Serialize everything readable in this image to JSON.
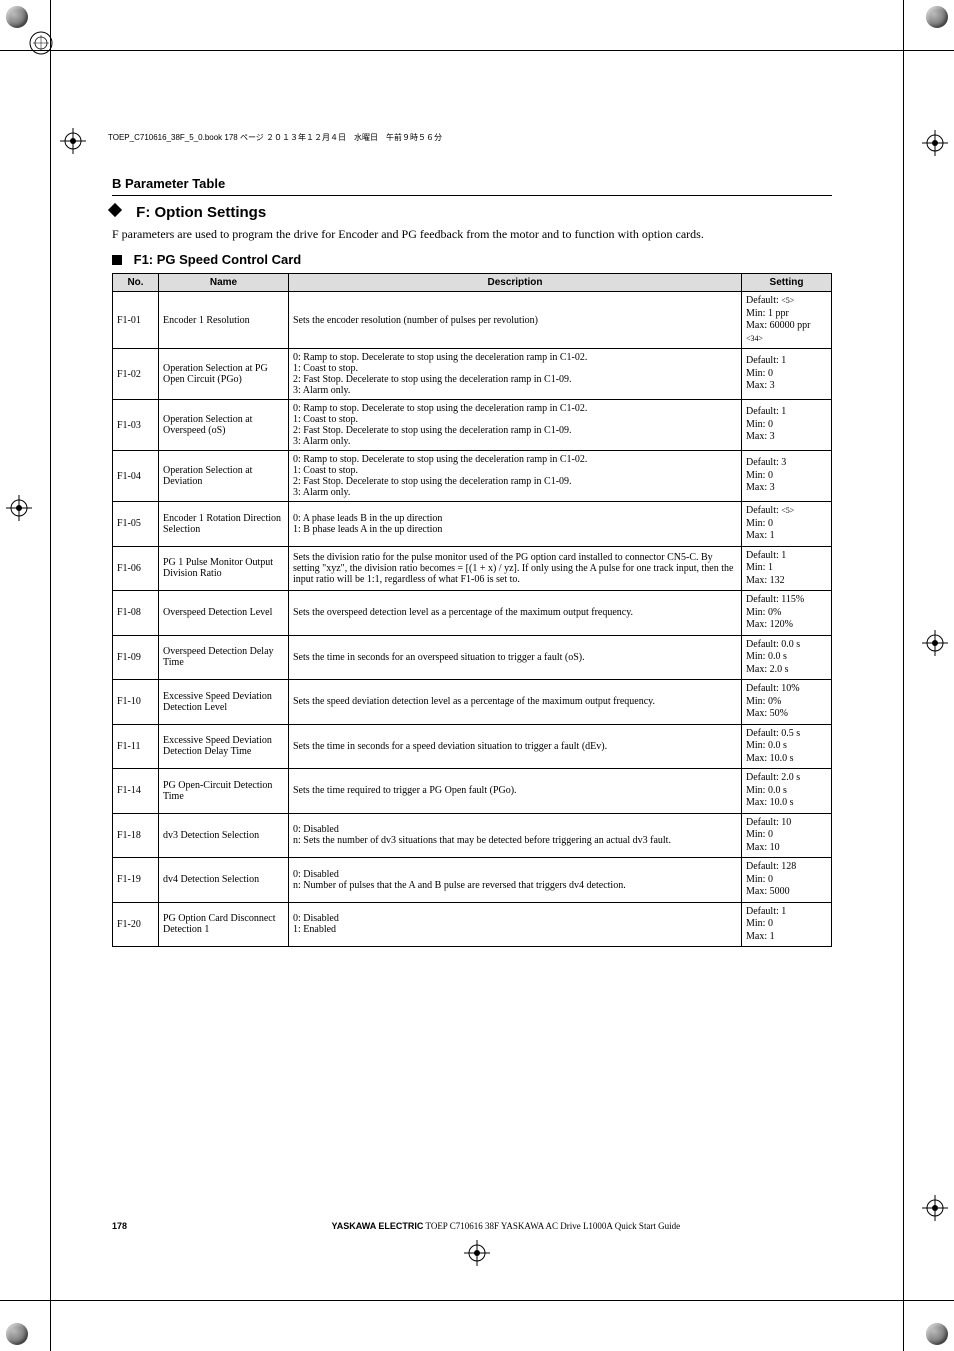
{
  "print_header": "TOEP_C710616_38F_5_0.book  178 ページ  ２０１３年１２月４日　水曜日　午前９時５６分",
  "section_header": "B  Parameter Table",
  "h2": "F: Option Settings",
  "intro": "F parameters are used to program the drive for Encoder and PG feedback from the motor and to function with option cards.",
  "h3": "F1: PG Speed Control Card",
  "columns": {
    "no": "No.",
    "name": "Name",
    "desc": "Description",
    "set": "Setting"
  },
  "rows": [
    {
      "no": "F1-01",
      "name": "Encoder 1 Resolution",
      "desc": "Sets the encoder resolution (number of pulses per revolution)",
      "setting": [
        "Default: <5>",
        "Min: 1 ppr",
        "Max: 60000 ppr <34>"
      ]
    },
    {
      "no": "F1-02",
      "name": "Operation Selection at PG Open Circuit (PGo)",
      "desc": "0: Ramp to stop. Decelerate to stop using the deceleration ramp in C1-02.\n1: Coast to stop.\n2: Fast Stop. Decelerate to stop using the deceleration ramp in C1-09.\n3: Alarm only.",
      "setting": [
        "Default: 1",
        "Min: 0",
        "Max: 3"
      ]
    },
    {
      "no": "F1-03",
      "name": "Operation Selection at Overspeed (oS)",
      "desc": "0: Ramp to stop. Decelerate to stop using the deceleration ramp in C1-02.\n1: Coast to stop.\n2: Fast Stop. Decelerate to stop using the deceleration ramp in C1-09.\n3: Alarm only.",
      "setting": [
        "Default: 1",
        "Min: 0",
        "Max: 3"
      ]
    },
    {
      "no": "F1-04",
      "name": "Operation Selection at Deviation",
      "desc": "0: Ramp to stop. Decelerate to stop using the deceleration ramp in C1-02.\n1: Coast to stop.\n2: Fast Stop. Decelerate to stop using the deceleration ramp in C1-09.\n3: Alarm only.",
      "setting": [
        "Default: 3",
        "Min: 0",
        "Max: 3"
      ]
    },
    {
      "no": "F1-05",
      "name": "Encoder 1 Rotation Direction Selection",
      "desc": "0: A phase leads B in the up direction\n1: B phase leads A in the up direction",
      "setting": [
        "Default: <5>",
        "Min: 0",
        "Max: 1"
      ]
    },
    {
      "no": "F1-06",
      "name": "PG 1 Pulse Monitor Output Division Ratio",
      "desc": "Sets the division ratio for the pulse monitor used of the PG option card installed to connector CN5-C. By setting \"xyz\", the division ratio becomes = [(1 + x) / yz]. If only using the A pulse for one track input, then the input ratio will be 1:1, regardless of what F1-06 is set to.",
      "setting": [
        "Default: 1",
        "Min: 1",
        "Max: 132"
      ]
    },
    {
      "no": "F1-08",
      "name": "Overspeed Detection Level",
      "desc": "Sets the overspeed detection level as a percentage of the maximum output frequency.",
      "setting": [
        "Default: 115%",
        "Min: 0%",
        "Max: 120%"
      ]
    },
    {
      "no": "F1-09",
      "name": "Overspeed Detection Delay Time",
      "desc": "Sets the time in seconds for an overspeed situation to trigger a fault (oS).",
      "setting": [
        "Default: 0.0 s",
        "Min: 0.0 s",
        "Max: 2.0 s"
      ]
    },
    {
      "no": "F1-10",
      "name": "Excessive Speed Deviation Detection Level",
      "desc": "Sets the speed deviation detection level as a percentage of the maximum output frequency.",
      "setting": [
        "Default: 10%",
        "Min: 0%",
        "Max: 50%"
      ]
    },
    {
      "no": "F1-11",
      "name": "Excessive Speed Deviation Detection Delay Time",
      "desc": "Sets the time in seconds for a speed deviation situation to trigger a fault (dEv).",
      "setting": [
        "Default: 0.5 s",
        "Min: 0.0 s",
        "Max: 10.0 s"
      ]
    },
    {
      "no": "F1-14",
      "name": "PG Open-Circuit Detection Time",
      "desc": "Sets the time required to trigger a PG Open fault (PGo).",
      "setting": [
        "Default: 2.0 s",
        "Min: 0.0 s",
        "Max: 10.0 s"
      ]
    },
    {
      "no": "F1-18",
      "name": "dv3 Detection Selection",
      "desc": "0: Disabled\nn: Sets the number of dv3 situations that may be detected before triggering an actual dv3 fault.",
      "setting": [
        "Default: 10",
        "Min: 0",
        "Max: 10"
      ]
    },
    {
      "no": "F1-19",
      "name": "dv4 Detection Selection",
      "desc": "0: Disabled\nn: Number of pulses that the A and B pulse are reversed that triggers dv4 detection.",
      "setting": [
        "Default: 128",
        "Min: 0",
        "Max: 5000"
      ]
    },
    {
      "no": "F1-20",
      "name": "PG Option Card Disconnect Detection 1",
      "desc": "0: Disabled\n1: Enabled",
      "setting": [
        "Default: 1",
        "Min: 0",
        "Max: 1"
      ]
    }
  ],
  "footer": {
    "page": "178",
    "title": "YASKAWA ELECTRIC",
    "rest": " TOEP C710616 38F YASKAWA AC Drive L1000A Quick Start Guide"
  }
}
